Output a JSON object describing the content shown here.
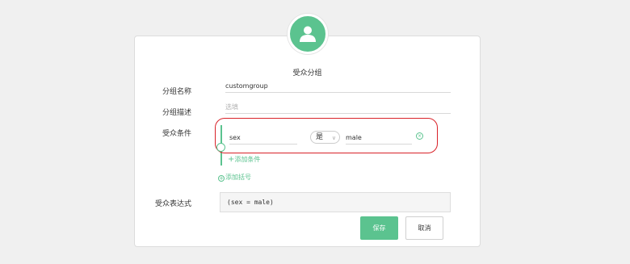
{
  "header": {
    "title": "受众分组",
    "avatar_icon": "user-icon"
  },
  "form": {
    "name_label": "分组名称",
    "name_value": "customgroup",
    "desc_label": "分组描述",
    "desc_placeholder": "选填",
    "conditions_label": "受众条件",
    "condition": {
      "field": "sex",
      "operator": "是",
      "value": "male"
    },
    "add_condition": "添加条件",
    "add_paren": "添加括号",
    "expression_label": "受众表达式",
    "expression_value": "(sex = male)"
  },
  "buttons": {
    "save": "保存",
    "cancel": "取消"
  },
  "colors": {
    "accent": "#5bc38f",
    "highlight": "#d92128",
    "background": "#f0f0f0"
  }
}
